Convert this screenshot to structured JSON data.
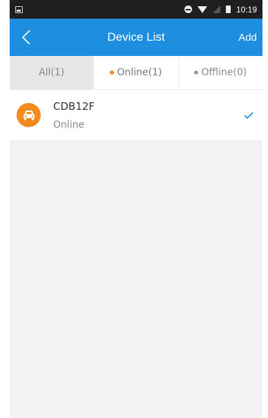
{
  "status_bar": {
    "time": "10:19",
    "icons": [
      "picture-icon",
      "dnd-icon",
      "wifi-icon",
      "signal-icon",
      "battery-icon"
    ]
  },
  "header": {
    "title": "Device List",
    "add_label": "Add",
    "back_icon": "chevron-left-icon"
  },
  "tabs": [
    {
      "label": "All(1)",
      "active": true
    },
    {
      "label": "Online(1)",
      "dot_color": "#f08a1c"
    },
    {
      "label": "Offline(0)",
      "dot_color": "#999999"
    }
  ],
  "devices": [
    {
      "name": "CDB12F",
      "status": "Online",
      "icon": "car-icon",
      "icon_color": "#f28a1d",
      "selected": true
    }
  ],
  "colors": {
    "accent": "#1e8fe0",
    "online": "#f08a1c"
  }
}
